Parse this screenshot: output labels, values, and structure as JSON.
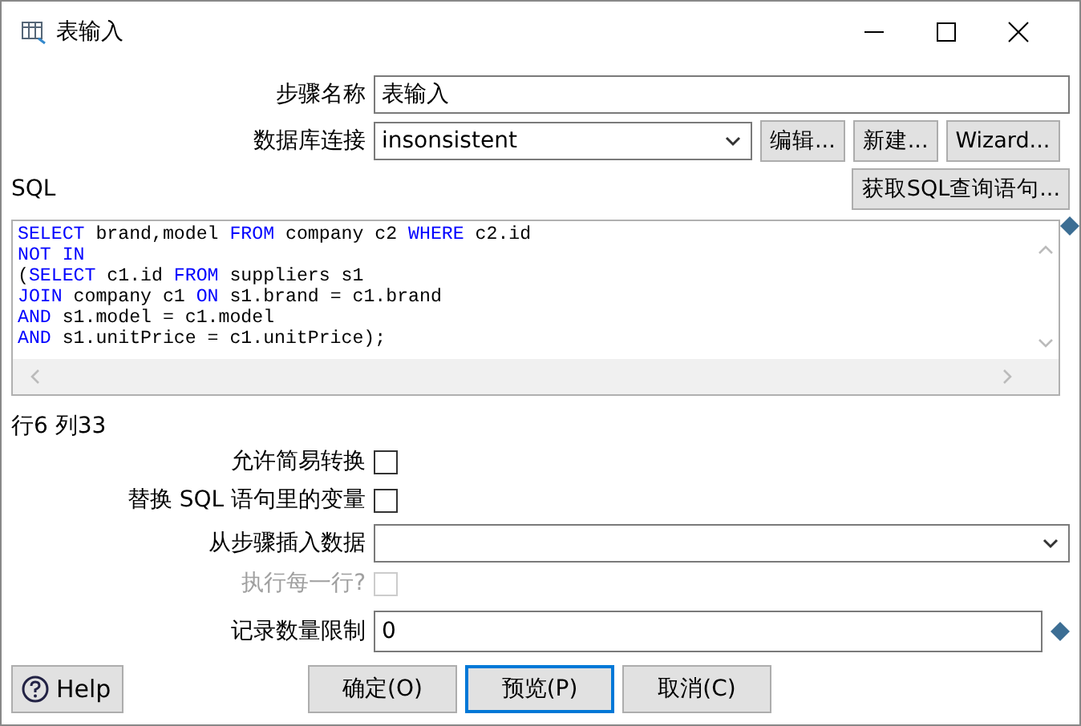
{
  "window": {
    "title": "表输入"
  },
  "step_name": {
    "label": "步骤名称",
    "value": "表输入"
  },
  "connection": {
    "label": "数据库连接",
    "value": "insonsistent",
    "buttons": [
      "编辑...",
      "新建...",
      "Wizard..."
    ]
  },
  "sql": {
    "label": "SQL",
    "get_button": "获取SQL查询语句...",
    "lines": [
      [
        {
          "text": "SELECT",
          "kind": "keyword"
        },
        {
          "text": " brand,model ",
          "kind": "plain"
        },
        {
          "text": "FROM",
          "kind": "keyword"
        },
        {
          "text": " company c2 ",
          "kind": "plain"
        },
        {
          "text": "WHERE",
          "kind": "keyword"
        },
        {
          "text": " c2.id",
          "kind": "plain"
        }
      ],
      [
        {
          "text": "NOT IN",
          "kind": "keyword"
        }
      ],
      [
        {
          "text": "(",
          "kind": "plain"
        },
        {
          "text": "SELECT",
          "kind": "keyword"
        },
        {
          "text": " c1.id ",
          "kind": "plain"
        },
        {
          "text": "FROM",
          "kind": "keyword"
        },
        {
          "text": " suppliers s1",
          "kind": "plain"
        }
      ],
      [
        {
          "text": "JOIN",
          "kind": "keyword"
        },
        {
          "text": " company c1 ",
          "kind": "plain"
        },
        {
          "text": "ON",
          "kind": "keyword"
        },
        {
          "text": " s1.brand = c1.brand",
          "kind": "plain"
        }
      ],
      [
        {
          "text": "AND",
          "kind": "keyword"
        },
        {
          "text": " s1.model = c1.model",
          "kind": "plain"
        }
      ],
      [
        {
          "text": "AND",
          "kind": "keyword"
        },
        {
          "text": " s1.unitPrice = c1.unitPrice);",
          "kind": "plain"
        }
      ]
    ],
    "position": "行6 列33"
  },
  "options": [
    {
      "label": "允许简易转换",
      "checked": false,
      "disabled": false
    },
    {
      "label": "替换 SQL 语句里的变量",
      "checked": false,
      "disabled": false
    }
  ],
  "insert_from_step": {
    "label": "从步骤插入数据"
  },
  "execute_each_row": {
    "label": "执行每一行?",
    "checked": false,
    "disabled": true
  },
  "limit": {
    "label": "记录数量限制",
    "value": "0"
  },
  "help_button": "Help",
  "buttons": [
    {
      "label": "确定(O)",
      "selected": false
    },
    {
      "label": "预览(P)",
      "selected": true
    },
    {
      "label": "取消(C)",
      "selected": false
    }
  ]
}
